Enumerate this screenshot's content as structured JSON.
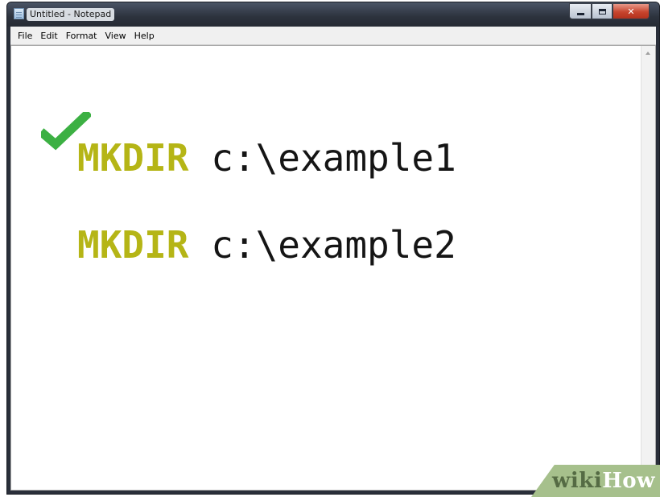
{
  "window": {
    "title": "Untitled - Notepad"
  },
  "menu": {
    "items": [
      "File",
      "Edit",
      "Format",
      "View",
      "Help"
    ]
  },
  "editor": {
    "lines": [
      {
        "keyword": "MKDIR",
        "argument": "c:\\example1"
      },
      {
        "keyword": "MKDIR",
        "argument": "c:\\example2"
      }
    ]
  },
  "watermark": {
    "part1": "wiki",
    "part2": "How"
  },
  "icons": {
    "checkmark": "checkmark-icon",
    "app": "notepad-icon"
  },
  "colors": {
    "keyword": "#b5b516",
    "checkmark": "#3cb043",
    "watermark_bg": "#a6c08c"
  }
}
